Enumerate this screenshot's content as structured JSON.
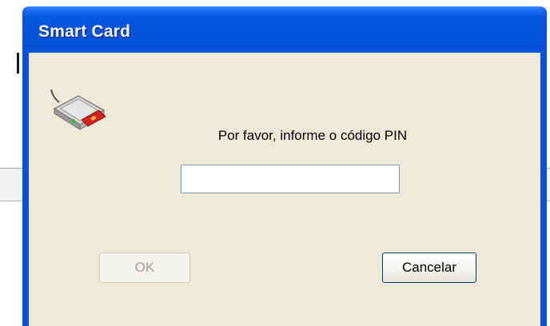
{
  "dialog": {
    "title": "Smart Card",
    "prompt": "Por favor, informe o código PIN",
    "pin_value": "",
    "ok_label": "OK",
    "cancel_label": "Cancelar",
    "icon": "smart-card-reader-icon"
  },
  "colors": {
    "titlebar": "#0553dc",
    "client_background": "#ece9d8",
    "title_text": "#ffffff",
    "disabled_text": "#a19e8c"
  }
}
